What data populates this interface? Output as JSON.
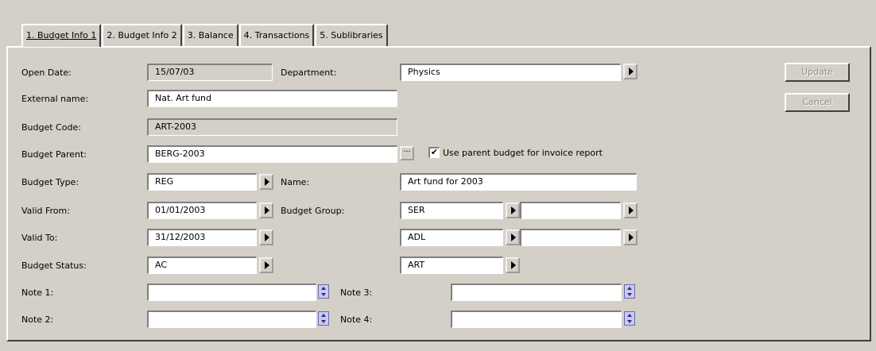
{
  "tabs": [
    "1. Budget Info 1",
    "2. Budget Info 2",
    "3. Balance",
    "4. Transactions",
    "5. Sublibraries"
  ],
  "labels": {
    "open_date": "Open Date:",
    "department": "Department:",
    "external_name": "External name:",
    "budget_code": "Budget Code:",
    "budget_parent": "Budget Parent:",
    "budget_type": "Budget Type:",
    "name": "Name:",
    "valid_from": "Valid From:",
    "budget_group": "Budget Group:",
    "valid_to": "Valid To:",
    "budget_status": "Budget Status:",
    "note1": "Note 1:",
    "note2": "Note 2:",
    "note3": "Note 3:",
    "note4": "Note 4:"
  },
  "values": {
    "open_date": "15/07/03",
    "department": "Physics",
    "external_name": "Nat. Art fund",
    "budget_code": "ART-2003",
    "budget_parent": "BERG-2003",
    "budget_type": "REG",
    "name": "Art fund for 2003",
    "valid_from": "01/01/2003",
    "valid_to": "31/12/2003",
    "budget_status": "AC",
    "budget_group_1": "SER",
    "budget_group_2": "ADL",
    "budget_group_3": "ART",
    "note1": "",
    "note2": "",
    "note3": "",
    "note4": ""
  },
  "checkbox": {
    "label": "Use parent budget for invoice report",
    "checked_glyph": "✔"
  },
  "ellipsis": "···",
  "buttons": {
    "update": "Update",
    "cancel": "Cancel"
  }
}
